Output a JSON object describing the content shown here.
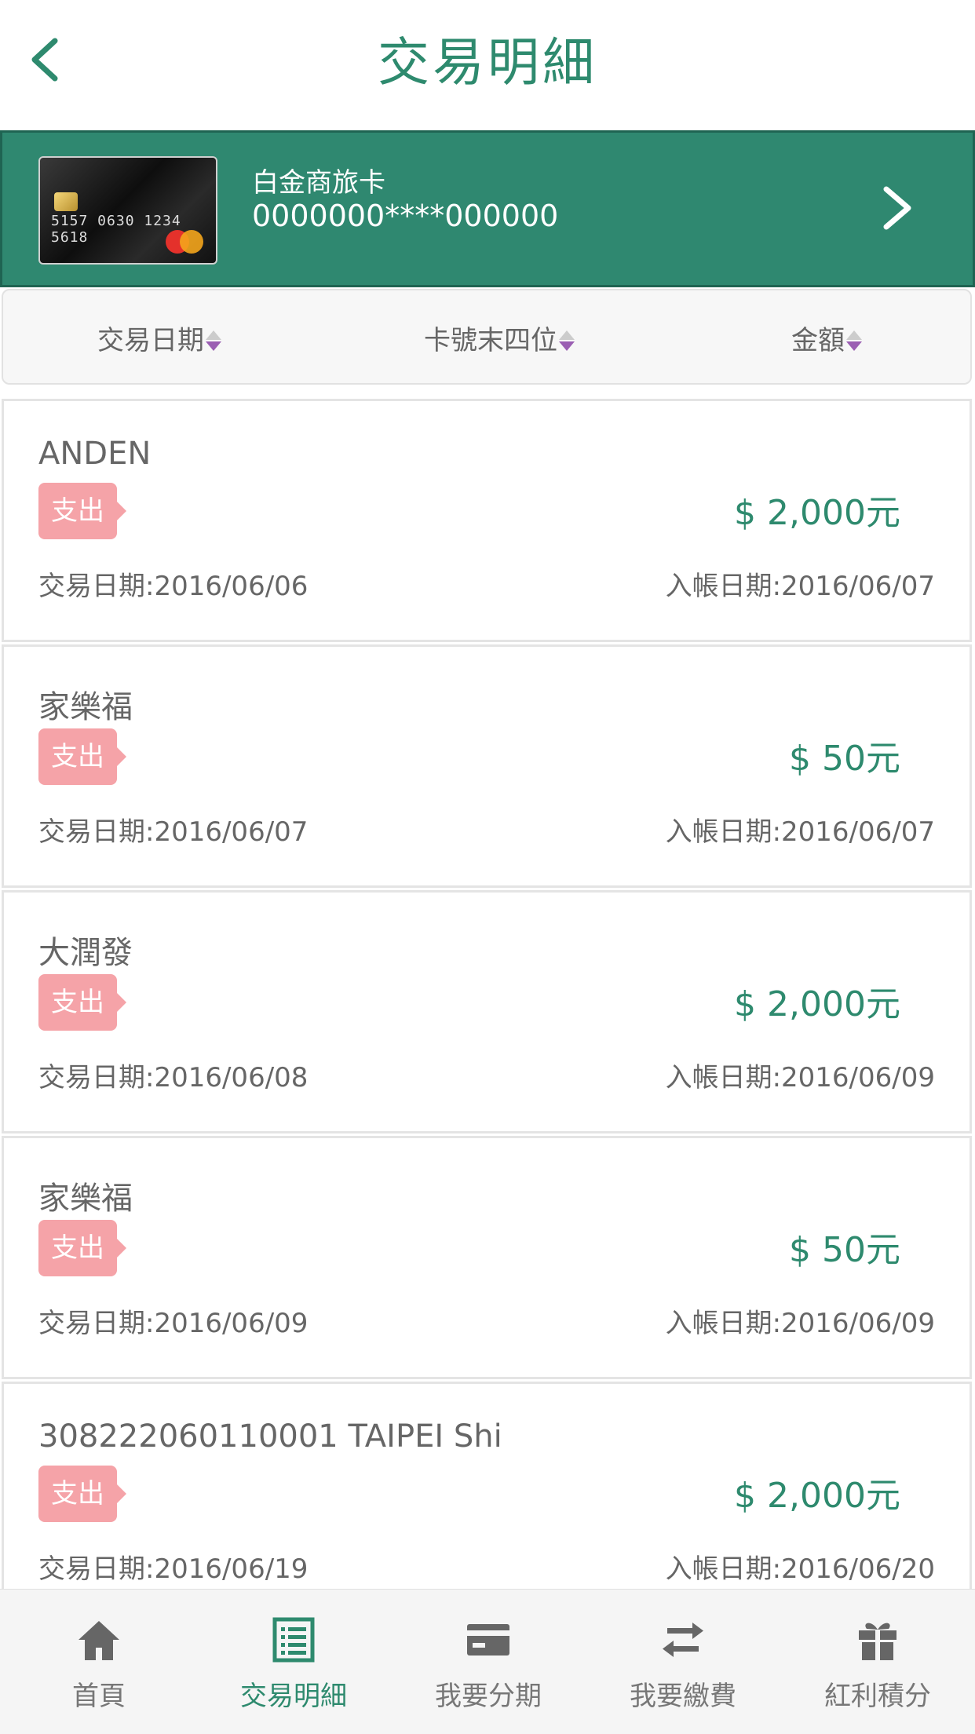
{
  "header": {
    "title": "交易明細"
  },
  "card": {
    "name": "白金商旅卡",
    "number": "0000000****000000"
  },
  "sort_bar": {
    "items": [
      {
        "label": "交易日期"
      },
      {
        "label": "卡號末四位"
      },
      {
        "label": "金額"
      }
    ]
  },
  "transactions": [
    {
      "merchant": "ANDEN",
      "type": "支出",
      "amount": "$ 2,000元",
      "txn_date": "交易日期:2016/06/06",
      "post_date": "入帳日期:2016/06/07"
    },
    {
      "merchant": "家樂福",
      "type": "支出",
      "amount": "$ 50元",
      "txn_date": "交易日期:2016/06/07",
      "post_date": "入帳日期:2016/06/07"
    },
    {
      "merchant": "大潤發",
      "type": "支出",
      "amount": "$ 2,000元",
      "txn_date": "交易日期:2016/06/08",
      "post_date": "入帳日期:2016/06/09"
    },
    {
      "merchant": "家樂福",
      "type": "支出",
      "amount": "$ 50元",
      "txn_date": "交易日期:2016/06/09",
      "post_date": "入帳日期:2016/06/09"
    },
    {
      "merchant": "308222060110001 TAIPEI Shi",
      "type": "支出",
      "amount": "$ 2,000元",
      "txn_date": "交易日期:2016/06/19",
      "post_date": "入帳日期:2016/06/20"
    }
  ],
  "tabbar": {
    "tabs": [
      {
        "label": "首頁",
        "icon": "home-icon"
      },
      {
        "label": "交易明細",
        "icon": "list-icon",
        "active": true
      },
      {
        "label": "我要分期",
        "icon": "card-icon"
      },
      {
        "label": "我要繳費",
        "icon": "transfer-icon"
      },
      {
        "label": "紅利積分",
        "icon": "gift-icon"
      }
    ]
  },
  "colors": {
    "brand_green": "#2e8a6e",
    "badge_pink": "#f5a3a8",
    "sort_arrow_purple": "#9b5fb3"
  }
}
